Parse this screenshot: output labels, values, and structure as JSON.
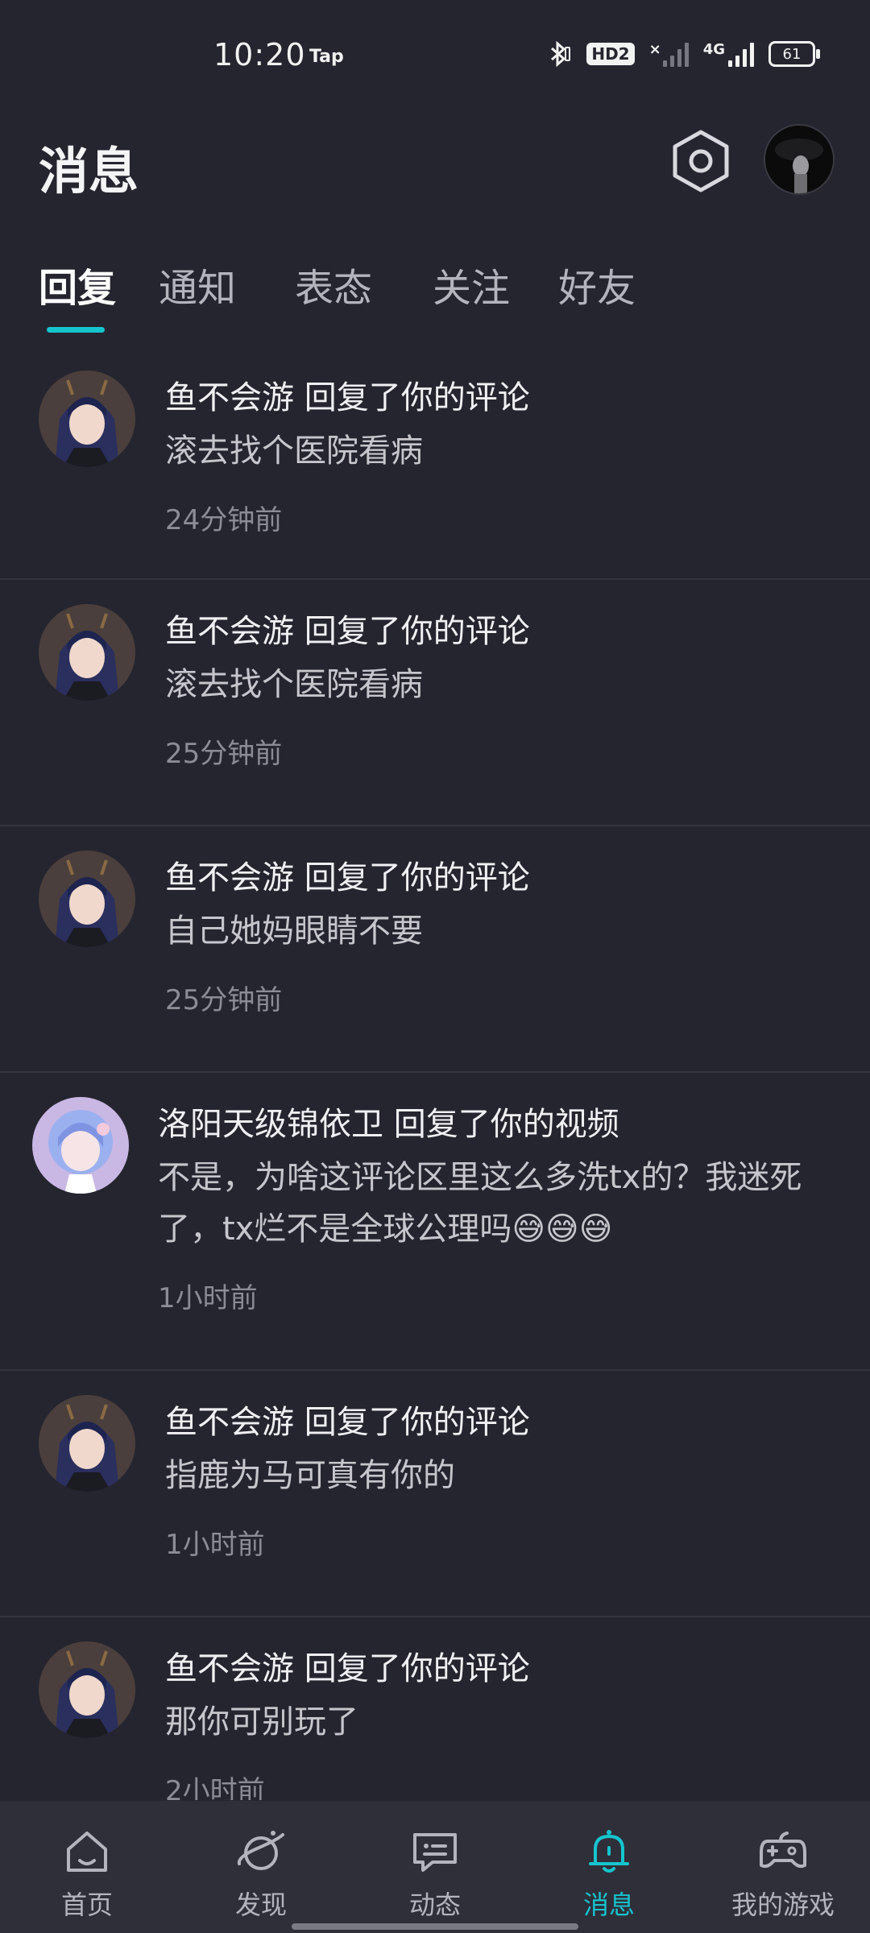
{
  "status_bar": {
    "time": "10:20",
    "carrier_app": "Tap",
    "hd_label": "HD2",
    "network_label": "4G",
    "battery": "61"
  },
  "header": {
    "title": "消息",
    "settings_icon": "hexagon-gear-icon",
    "avatar_icon": "user-avatar"
  },
  "tabs": [
    {
      "label": "回复",
      "active": true
    },
    {
      "label": "通知",
      "active": false
    },
    {
      "label": "表态",
      "active": false
    },
    {
      "label": "关注",
      "active": false
    },
    {
      "label": "好友",
      "active": false
    }
  ],
  "messages": [
    {
      "title": "鱼不会游 回复了你的评论",
      "content": "滚去找个医院看病",
      "time": "24分钟前"
    },
    {
      "title": "鱼不会游 回复了你的评论",
      "content": "滚去找个医院看病",
      "time": "25分钟前"
    },
    {
      "title": "鱼不会游 回复了你的评论",
      "content": "自己她妈眼睛不要",
      "time": "25分钟前"
    },
    {
      "title": "洛阳天级锦依卫 回复了你的视频",
      "content": "不是，为啥这评论区里这么多洗tx的？我迷死了，tx烂不是全球公理吗😅😅😅",
      "time": "1小时前"
    },
    {
      "title": "鱼不会游 回复了你的评论",
      "content": "指鹿为马可真有你的",
      "time": "1小时前"
    },
    {
      "title": "鱼不会游 回复了你的评论",
      "content": "那你可别玩了",
      "time": "2小时前"
    }
  ],
  "bottom_nav": [
    {
      "label": "首页",
      "icon": "home-icon",
      "active": false
    },
    {
      "label": "发现",
      "icon": "planet-icon",
      "active": false
    },
    {
      "label": "动态",
      "icon": "chat-bubble-icon",
      "active": false
    },
    {
      "label": "消息",
      "icon": "bell-icon",
      "active": true
    },
    {
      "label": "我的游戏",
      "icon": "gamepad-icon",
      "active": false
    }
  ],
  "colors": {
    "background": "#25252f",
    "accent": "#15c5ce",
    "nav_background": "#2f2f3a",
    "divider": "#34343e"
  }
}
